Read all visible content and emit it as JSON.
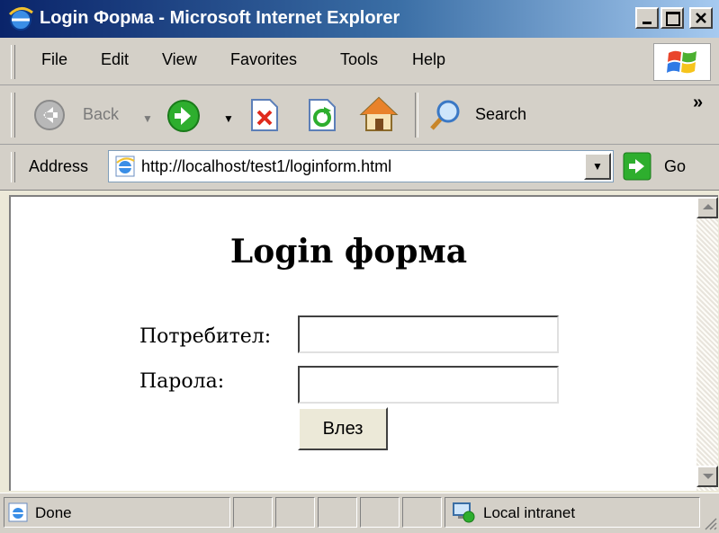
{
  "window": {
    "title": "Login Форма - Microsoft Internet Explorer",
    "icon": "ie-icon",
    "controls": {
      "minimize": "_",
      "maximize": "☐",
      "close": "✕"
    }
  },
  "menu": {
    "items": [
      {
        "label": "File"
      },
      {
        "label": "Edit"
      },
      {
        "label": "View"
      },
      {
        "label": "Favorites"
      },
      {
        "label": "Tools"
      },
      {
        "label": "Help"
      }
    ]
  },
  "toolbar": {
    "back_label": "Back",
    "search_label": "Search",
    "overflow": "»"
  },
  "address": {
    "label": "Address",
    "url": "http://localhost/test1/loginform.html",
    "go_label": "Go"
  },
  "page": {
    "title": "Login форма",
    "username_label": "Потребител:",
    "username_value": "",
    "password_label": "Парола:",
    "password_value": "",
    "submit_label": "Влез"
  },
  "status": {
    "text": "Done",
    "zone": "Local intranet"
  },
  "colors": {
    "titlebar_start": "#0a246a",
    "titlebar_end": "#a6caf0",
    "chrome": "#d4d0c8",
    "go_green": "#2eae2e"
  }
}
